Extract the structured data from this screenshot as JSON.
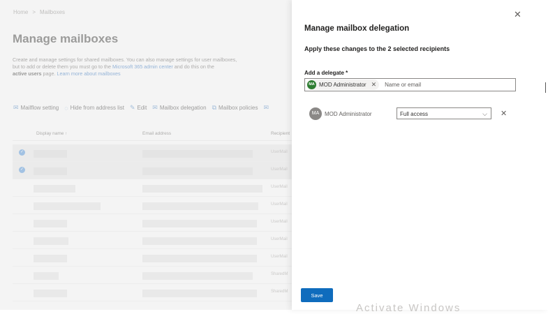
{
  "breadcrumb": {
    "home": "Home",
    "separator": ">",
    "current": "Mailboxes"
  },
  "page": {
    "title": "Manage mailboxes",
    "description_line1": "Create and manage settings for shared mailboxes. You can also manage settings for user mailboxes,",
    "description_line2_prefix": "but to add or delete them you must go to the ",
    "description_link": "Microsoft 365 admin center",
    "description_line2_suffix": " and do this on the",
    "description_bold": "active users",
    "description_line3_suffix": " page. ",
    "learn_more": "Learn more about mailboxes"
  },
  "toolbar": {
    "mailflow": "Mailflow setting",
    "hide": "Hide from address list",
    "edit": "Edit",
    "delegation": "Mailbox delegation",
    "policies": "Mailbox policies"
  },
  "table": {
    "col_display": "Display name ↑",
    "col_email": "Email address",
    "col_type": "Recipient",
    "rows": [
      {
        "selected": true,
        "type": "UserMail"
      },
      {
        "selected": true,
        "type": "UserMail"
      },
      {
        "selected": false,
        "type": "UserMail"
      },
      {
        "selected": false,
        "type": "UserMail"
      },
      {
        "selected": false,
        "type": "UserMail"
      },
      {
        "selected": false,
        "type": "UserMail"
      },
      {
        "selected": false,
        "type": "UserMail"
      },
      {
        "selected": false,
        "type": "SharedM"
      },
      {
        "selected": false,
        "type": "SharedM"
      }
    ]
  },
  "panel": {
    "title": "Manage mailbox delegation",
    "subtitle": "Apply these changes to the 2 selected recipients",
    "delegate_label": "Add a delegate *",
    "chip_initials": "MA",
    "chip_name": "MOD Administrator",
    "input_placeholder": "Name or email",
    "delegate_initials": "MA",
    "delegate_name": "MOD Administrator",
    "permission": "Full access",
    "save": "Save"
  },
  "watermark": "Activate Windows",
  "colors": {
    "accent": "#0f6cbd",
    "chip_avatar": "#2e7d32",
    "link": "#2a6fbf"
  }
}
